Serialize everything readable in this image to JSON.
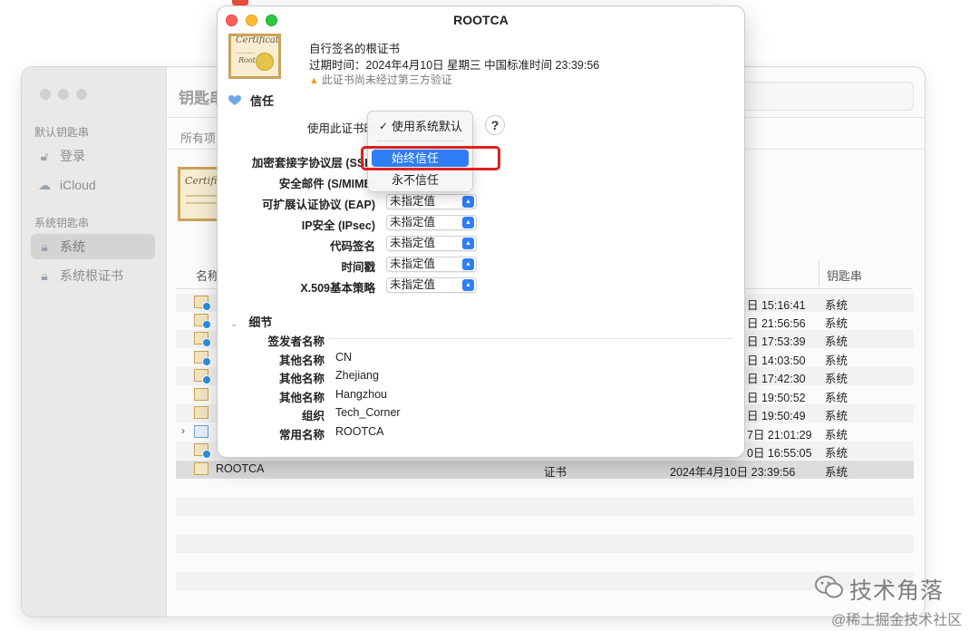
{
  "keychain_window": {
    "title": "钥匙串",
    "sidebar": {
      "section1": "默认钥匙串",
      "items1": [
        {
          "label": "登录",
          "icon": "lock-open-icon"
        },
        {
          "label": "iCloud",
          "icon": "cloud-icon"
        }
      ],
      "section2": "系统钥匙串",
      "items2": [
        {
          "label": "系统",
          "icon": "lock-icon"
        },
        {
          "label": "系统根证书",
          "icon": "lock-icon"
        }
      ]
    },
    "tab_all": "所有项",
    "columns": {
      "name": "名称",
      "keychain": "钥匙串"
    },
    "rows": [
      {
        "date": "日 15:16:41",
        "keychain": "系统"
      },
      {
        "date": "日 21:56:56",
        "keychain": "系统"
      },
      {
        "date": "日 17:53:39",
        "keychain": "系统"
      },
      {
        "date": "日 14:03:50",
        "keychain": "系统"
      },
      {
        "date": "日 17:42:30",
        "keychain": "系统"
      },
      {
        "date": "日 19:50:52",
        "keychain": "系统"
      },
      {
        "date": "日 19:50:49",
        "keychain": "系统"
      },
      {
        "date": "7日 21:01:29",
        "keychain": "系统"
      },
      {
        "date": "0日 16:55:05",
        "keychain": "系统"
      }
    ],
    "selected_row": {
      "name": "ROOTCA",
      "kind": "证书",
      "date": "2024年4月10日 23:39:56",
      "keychain": "系统"
    }
  },
  "sheet": {
    "title": "ROOTCA",
    "thumb_script": "Certificate",
    "thumb_script2": "Root",
    "subtitle": "自行签名的根证书",
    "expiry": "过期时间：2024年4月10日 星期三 中国标准时间 23:39:56",
    "warning": "此证书尚未经过第三方验证",
    "trust_section": "信任",
    "trust_rows": [
      {
        "label": "使用此证书时",
        "value": "",
        "bold": false
      },
      {
        "label": "加密套接字协议层 (SSL)",
        "value": "",
        "bold": true
      },
      {
        "label": "安全邮件 (S/MIME)",
        "value": "",
        "bold": true
      },
      {
        "label": "可扩展认证协议 (EAP)",
        "value": "未指定值",
        "bold": true
      },
      {
        "label": "IP安全 (IPsec)",
        "value": "未指定值",
        "bold": true
      },
      {
        "label": "代码签名",
        "value": "未指定值",
        "bold": true
      },
      {
        "label": "时间戳",
        "value": "未指定值",
        "bold": true
      },
      {
        "label": "X.509基本策略",
        "value": "未指定值",
        "bold": true
      }
    ],
    "help": "?",
    "details_section": "细节",
    "issuer_heading": "签发者名称",
    "details": [
      {
        "label": "其他名称",
        "value": "CN"
      },
      {
        "label": "其他名称",
        "value": "Zhejiang"
      },
      {
        "label": "其他名称",
        "value": "Hangzhou"
      },
      {
        "label": "组织",
        "value": "Tech_Corner"
      },
      {
        "label": "常用名称",
        "value": "ROOTCA"
      }
    ]
  },
  "dropdown_menu": {
    "items": [
      {
        "label": "使用系统默认",
        "checked": true,
        "highlighted": false
      },
      {
        "label": "始终信任",
        "checked": false,
        "highlighted": true
      },
      {
        "label": "永不信任",
        "checked": false,
        "highlighted": false
      }
    ],
    "checkmark": "✓"
  },
  "watermark": {
    "main": "技术角落",
    "sub": "@稀土掘金技术社区"
  },
  "colors": {
    "accent": "#2f7ef6",
    "highlight_box": "#e0201e",
    "cert_gold": "#caa35a"
  }
}
